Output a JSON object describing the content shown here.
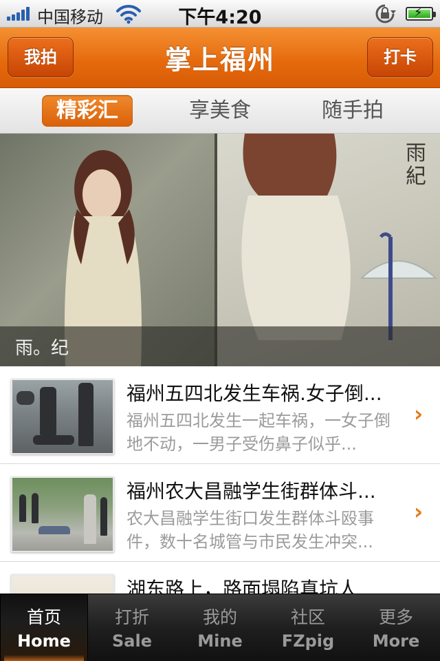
{
  "status_bar": {
    "carrier": "中国移动",
    "time": "下午4:20",
    "icons": [
      "signal-icon",
      "wifi-icon",
      "rotation-lock-icon",
      "battery-charging-icon"
    ]
  },
  "nav": {
    "title": "掌上福州",
    "left_button": "我拍",
    "right_button": "打卡",
    "accent_color": "#e66b0e"
  },
  "segments": {
    "items": [
      {
        "label": "精彩汇",
        "active": true
      },
      {
        "label": "享美食",
        "active": false
      },
      {
        "label": "随手拍",
        "active": false
      }
    ]
  },
  "banner": {
    "caption": "雨。纪",
    "deco_text": "雨紀"
  },
  "news": {
    "items": [
      {
        "title": "福州五四北发生车祸.女子倒...",
        "desc": "福州五四北发生一起车祸，一女子倒地不动，一男子受伤鼻子似乎..."
      },
      {
        "title": "福州农大昌融学生街群体斗...",
        "desc": "农大昌融学生街口发生群体斗殴事件，数十名城管与市民发生冲突..."
      },
      {
        "title": "湖东路上，路面塌陷真坑人",
        "desc": ""
      }
    ]
  },
  "tab_bar": {
    "items": [
      {
        "cn": "首页",
        "en": "Home",
        "active": true
      },
      {
        "cn": "打折",
        "en": "Sale",
        "active": false
      },
      {
        "cn": "我的",
        "en": "Mine",
        "active": false
      },
      {
        "cn": "社区",
        "en": "FZpig",
        "active": false
      },
      {
        "cn": "更多",
        "en": "More",
        "active": false
      }
    ]
  }
}
